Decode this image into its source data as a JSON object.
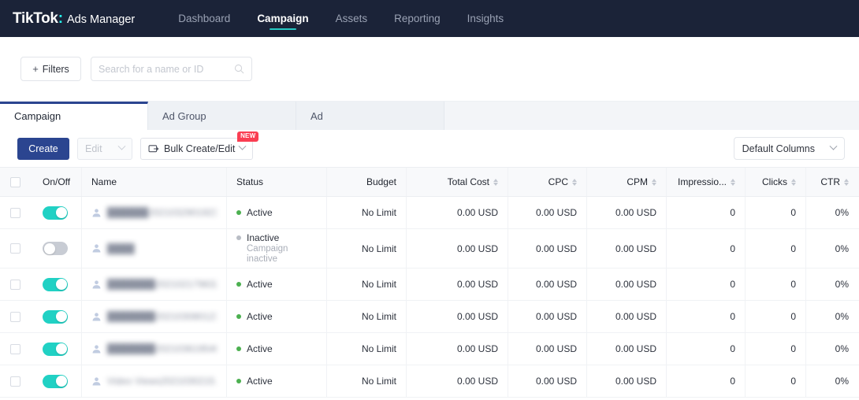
{
  "brand": {
    "name": "TikTok",
    "colon": ":",
    "product": "Ads Manager"
  },
  "topnav": {
    "items": [
      {
        "label": "Dashboard",
        "active": false
      },
      {
        "label": "Campaign",
        "active": true
      },
      {
        "label": "Assets",
        "active": false
      },
      {
        "label": "Reporting",
        "active": false
      },
      {
        "label": "Insights",
        "active": false
      }
    ]
  },
  "filterbar": {
    "filters_label": "Filters",
    "search_placeholder": "Search for a name or ID",
    "search_value": ""
  },
  "tabs": [
    {
      "label": "Campaign",
      "active": true
    },
    {
      "label": "Ad Group",
      "active": false
    },
    {
      "label": "Ad",
      "active": false
    }
  ],
  "actionbar": {
    "create_label": "Create",
    "edit_label": "Edit",
    "bulk_label": "Bulk Create/Edit",
    "bulk_badge": "NEW",
    "columns_label": "Default Columns"
  },
  "table": {
    "columns": [
      {
        "key": "check",
        "label": "",
        "sortable": false
      },
      {
        "key": "onoff",
        "label": "On/Off",
        "sortable": false
      },
      {
        "key": "name",
        "label": "Name",
        "sortable": false
      },
      {
        "key": "status",
        "label": "Status",
        "sortable": false
      },
      {
        "key": "budget",
        "label": "Budget",
        "sortable": false
      },
      {
        "key": "cost",
        "label": "Total Cost",
        "sortable": true
      },
      {
        "key": "cpc",
        "label": "CPC",
        "sortable": true
      },
      {
        "key": "cpm",
        "label": "CPM",
        "sortable": true
      },
      {
        "key": "impr",
        "label": "Impressio...",
        "sortable": true
      },
      {
        "key": "clicks",
        "label": "Clicks",
        "sortable": true
      },
      {
        "key": "ctr",
        "label": "CTR",
        "sortable": true
      }
    ],
    "rows": [
      {
        "selected": false,
        "enabled": true,
        "name": "██████2021032901923145",
        "status": "Active",
        "status_sub": "",
        "status_color": "green",
        "budget": "No Limit",
        "cost": "0.00 USD",
        "cpc": "0.00 USD",
        "cpm": "0.00 USD",
        "impr": "0",
        "clicks": "0",
        "ctr": "0%"
      },
      {
        "selected": false,
        "enabled": false,
        "name": "████",
        "status": "Inactive",
        "status_sub": "Campaign inactive",
        "status_color": "gray",
        "budget": "No Limit",
        "cost": "0.00 USD",
        "cpc": "0.00 USD",
        "cpm": "0.00 USD",
        "impr": "0",
        "clicks": "0",
        "ctr": "0%"
      },
      {
        "selected": false,
        "enabled": true,
        "name": "███████2021021796322",
        "status": "Active",
        "status_sub": "",
        "status_color": "green",
        "budget": "No Limit",
        "cost": "0.00 USD",
        "cpc": "0.00 USD",
        "cpm": "0.00 USD",
        "impr": "0",
        "clicks": "0",
        "ctr": "0%"
      },
      {
        "selected": false,
        "enabled": true,
        "name": "███████2021030801234",
        "status": "Active",
        "status_sub": "",
        "status_color": "green",
        "budget": "No Limit",
        "cost": "0.00 USD",
        "cpc": "0.00 USD",
        "cpm": "0.00 USD",
        "impr": "0",
        "clicks": "0",
        "ctr": "0%"
      },
      {
        "selected": false,
        "enabled": true,
        "name": "███████2021036195409",
        "status": "Active",
        "status_sub": "",
        "status_color": "green",
        "budget": "No Limit",
        "cost": "0.00 USD",
        "cpc": "0.00 USD",
        "cpm": "0.00 USD",
        "impr": "0",
        "clicks": "0",
        "ctr": "0%"
      },
      {
        "selected": false,
        "enabled": true,
        "name": "Video Views2021030215…",
        "status": "Active",
        "status_sub": "",
        "status_color": "green",
        "budget": "No Limit",
        "cost": "0.00 USD",
        "cpc": "0.00 USD",
        "cpm": "0.00 USD",
        "impr": "0",
        "clicks": "0",
        "ctr": "0%"
      }
    ]
  },
  "colors": {
    "nav_bg": "#1b2338",
    "accent_teal": "#25c9c4",
    "primary_blue": "#2b4590",
    "toggle_on": "#21d1c4",
    "status_active": "#4cb050",
    "status_inactive": "#b9bdc5",
    "badge_red": "#fa3e52"
  }
}
